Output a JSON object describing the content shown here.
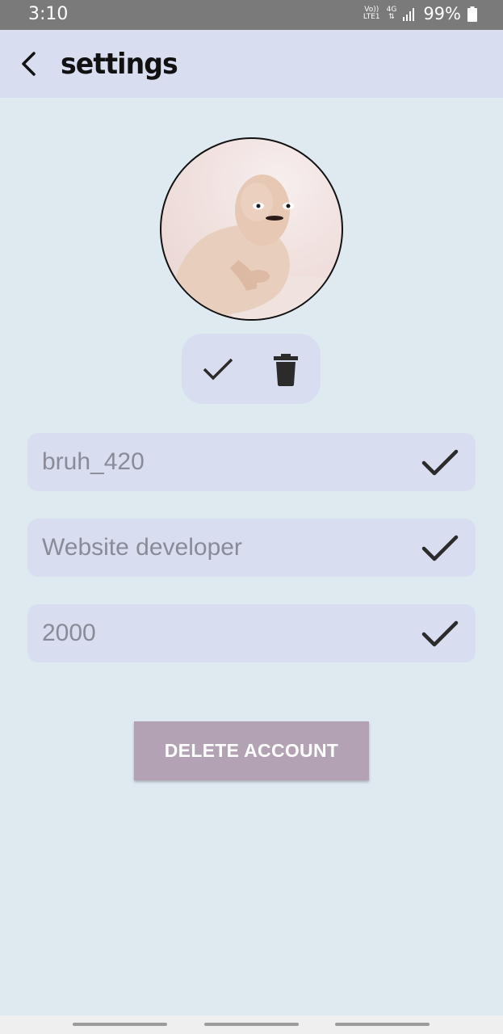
{
  "status_bar": {
    "time": "3:10",
    "volte_line1": "Vo))",
    "volte_line2": "LTE1",
    "network": "4G",
    "battery": "99%"
  },
  "header": {
    "title": "settings"
  },
  "form": {
    "username": "bruh_420",
    "occupation": "Website developer",
    "year": "2000"
  },
  "delete_button": {
    "label": "DELETE ACCOUNT"
  },
  "colors": {
    "background": "#dfe9f0",
    "surface": "#d8def0",
    "delete_button": "#b3a1b4",
    "status_bar": "#7a7a7a"
  }
}
